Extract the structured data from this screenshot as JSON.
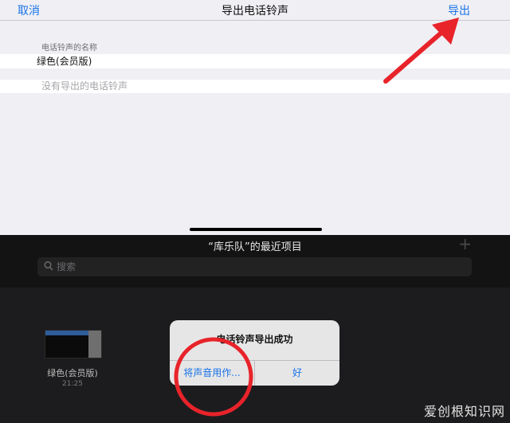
{
  "navbar": {
    "cancel": "取消",
    "title": "导出电话铃声",
    "export": "导出"
  },
  "form": {
    "name_label": "电话铃声的名称",
    "name_value": "绿色(会员版)",
    "empty_text": "没有导出的电话铃声"
  },
  "recents": {
    "title": "“库乐队”的最近项目",
    "plus": "+",
    "search_placeholder": "搜索"
  },
  "file": {
    "name": "绿色(会员版)",
    "time": "21:25"
  },
  "alert": {
    "title": "电话铃声导出成功",
    "use_as": "将声音用作...",
    "ok": "好"
  },
  "watermark": "爱创根知识网",
  "colors": {
    "accent": "#1a73e8",
    "annotation": "#e8232a"
  },
  "icons": {
    "search": "search-icon",
    "plus": "plus-icon",
    "arrow": "red-arrow-annotation",
    "circle": "red-circle-annotation"
  }
}
